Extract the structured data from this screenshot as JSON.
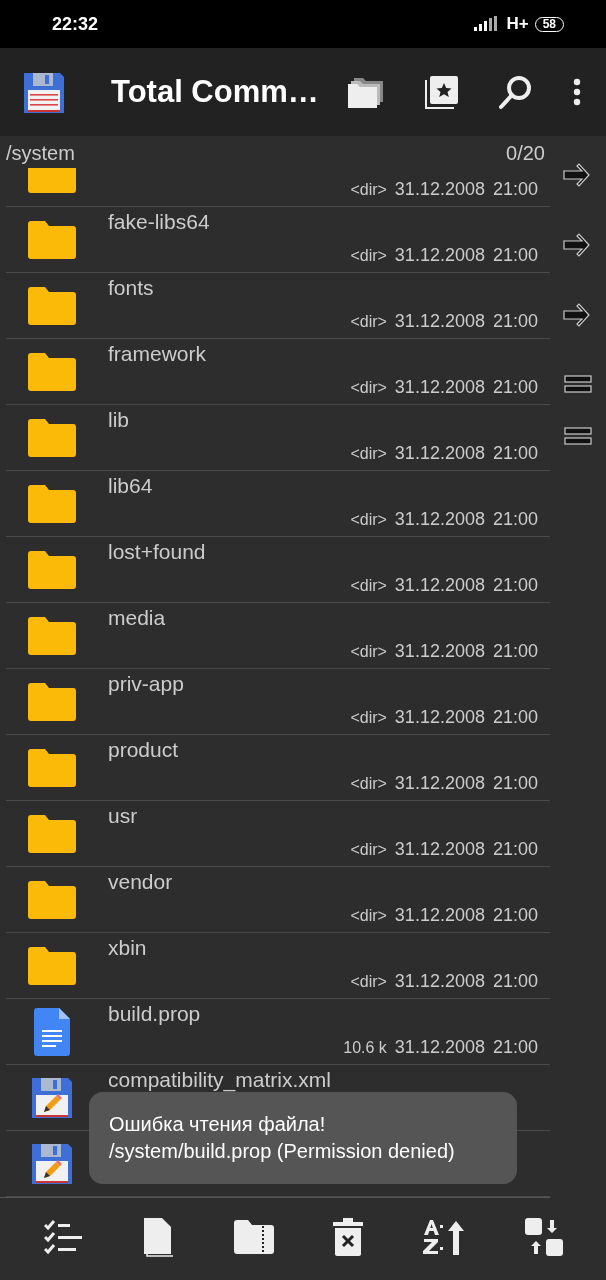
{
  "status_bar": {
    "time": "22:32",
    "network": "H+",
    "battery": "58"
  },
  "app_bar": {
    "title": "Total Comm…"
  },
  "panel": {
    "path": "/system",
    "count": "0/20"
  },
  "files": [
    {
      "kind": "folder",
      "size": "<dir>",
      "date": "31.12.2008",
      "time": "21:00"
    },
    {
      "kind": "folder",
      "name": "fake-libs64",
      "size": "<dir>",
      "date": "31.12.2008",
      "time": "21:00"
    },
    {
      "kind": "folder",
      "name": "fonts",
      "size": "<dir>",
      "date": "31.12.2008",
      "time": "21:00"
    },
    {
      "kind": "folder",
      "name": "framework",
      "size": "<dir>",
      "date": "31.12.2008",
      "time": "21:00"
    },
    {
      "kind": "folder",
      "name": "lib",
      "size": "<dir>",
      "date": "31.12.2008",
      "time": "21:00"
    },
    {
      "kind": "folder",
      "name": "lib64",
      "size": "<dir>",
      "date": "31.12.2008",
      "time": "21:00"
    },
    {
      "kind": "folder",
      "name": "lost+found",
      "size": "<dir>",
      "date": "31.12.2008",
      "time": "21:00"
    },
    {
      "kind": "folder",
      "name": "media",
      "size": "<dir>",
      "date": "31.12.2008",
      "time": "21:00"
    },
    {
      "kind": "folder",
      "name": "priv-app",
      "size": "<dir>",
      "date": "31.12.2008",
      "time": "21:00"
    },
    {
      "kind": "folder",
      "name": "product",
      "size": "<dir>",
      "date": "31.12.2008",
      "time": "21:00"
    },
    {
      "kind": "folder",
      "name": "usr",
      "size": "<dir>",
      "date": "31.12.2008",
      "time": "21:00"
    },
    {
      "kind": "folder",
      "name": "vendor",
      "size": "<dir>",
      "date": "31.12.2008",
      "time": "21:00"
    },
    {
      "kind": "folder",
      "name": "xbin",
      "size": "<dir>",
      "date": "31.12.2008",
      "time": "21:00"
    },
    {
      "kind": "document",
      "name": "build.prop",
      "size": "10.6 k",
      "date": "31.12.2008",
      "time": "21:00"
    },
    {
      "kind": "editable",
      "name": "compatibility_matrix.xml"
    },
    {
      "kind": "editable"
    }
  ],
  "side_buttons": [
    {
      "kind": "arrow"
    },
    {
      "kind": "arrow"
    },
    {
      "kind": "arrow"
    },
    {
      "kind": "equals"
    },
    {
      "kind": "equals"
    }
  ],
  "toast": {
    "lines": [
      "Ошибка чтения файла!",
      "/system/build.prop (Permission denied)"
    ]
  },
  "toolbar": [
    {
      "kind": "select"
    },
    {
      "kind": "copy"
    },
    {
      "kind": "zip"
    },
    {
      "kind": "delete"
    },
    {
      "kind": "sort"
    },
    {
      "kind": "swap"
    }
  ]
}
